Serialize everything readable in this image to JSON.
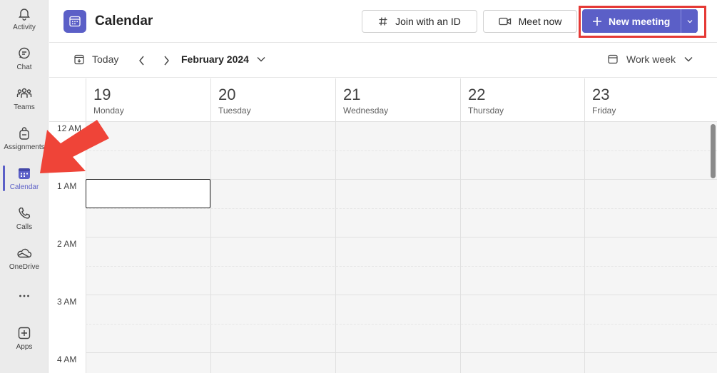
{
  "rail": {
    "items": [
      {
        "label": "Activity",
        "icon": "bell-icon"
      },
      {
        "label": "Chat",
        "icon": "chat-icon"
      },
      {
        "label": "Teams",
        "icon": "teams-icon"
      },
      {
        "label": "Assignments",
        "icon": "backpack-icon"
      },
      {
        "label": "Calendar",
        "icon": "calendar-icon"
      },
      {
        "label": "Calls",
        "icon": "phone-icon"
      },
      {
        "label": "OneDrive",
        "icon": "cloud-icon"
      },
      {
        "label": "",
        "icon": "more-icon"
      },
      {
        "label": "Apps",
        "icon": "add-apps-icon"
      }
    ],
    "active": "Calendar"
  },
  "header": {
    "title": "Calendar",
    "join_label": "Join with an ID",
    "meet_now_label": "Meet now",
    "new_meeting_label": "New meeting"
  },
  "toolbar": {
    "today_label": "Today",
    "month_label": "February 2024",
    "view_label": "Work week"
  },
  "days": [
    {
      "num": "19",
      "name": "Monday"
    },
    {
      "num": "20",
      "name": "Tuesday"
    },
    {
      "num": "21",
      "name": "Wednesday"
    },
    {
      "num": "22",
      "name": "Thursday"
    },
    {
      "num": "23",
      "name": "Friday"
    }
  ],
  "times": [
    "12 AM",
    "1 AM",
    "2 AM",
    "3 AM",
    "4 AM"
  ],
  "colors": {
    "accent": "#5b5fc7",
    "highlight": "#e53935"
  }
}
